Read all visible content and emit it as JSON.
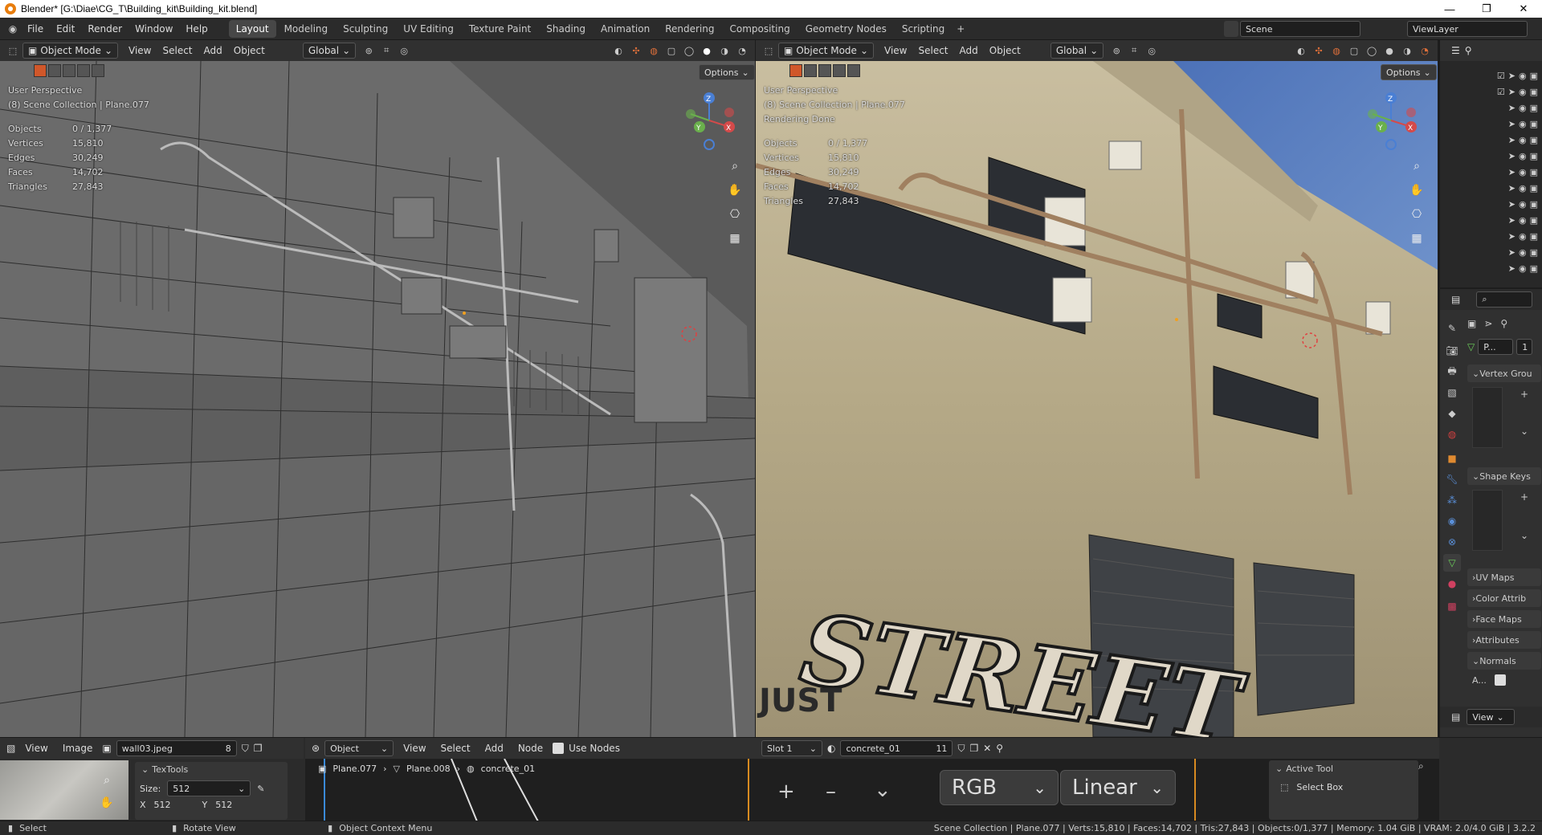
{
  "window": {
    "title": "Blender* [G:\\Diae\\CG_T\\Building_kit\\Building_kit.blend]"
  },
  "menu": [
    "File",
    "Edit",
    "Render",
    "Window",
    "Help"
  ],
  "workspaces": [
    "Layout",
    "Modeling",
    "Sculpting",
    "UV Editing",
    "Texture Paint",
    "Shading",
    "Animation",
    "Rendering",
    "Compositing",
    "Geometry Nodes",
    "Scripting"
  ],
  "scene": {
    "name": "Scene",
    "view_layer": "ViewLayer"
  },
  "viewport_header": {
    "mode": "Object Mode",
    "menus": [
      "View",
      "Select",
      "Add",
      "Object"
    ],
    "orientation": "Global"
  },
  "viewport_left": {
    "perspective": "User Perspective",
    "collection": "(8) Scene Collection | Plane.077",
    "options": "Options",
    "stats": [
      {
        "k": "Objects",
        "v": "0 / 1,377"
      },
      {
        "k": "Vertices",
        "v": "15,810"
      },
      {
        "k": "Edges",
        "v": "30,249"
      },
      {
        "k": "Faces",
        "v": "14,702"
      },
      {
        "k": "Triangles",
        "v": "27,843"
      }
    ]
  },
  "viewport_right": {
    "perspective": "User Perspective",
    "collection": "(8) Scene Collection | Plane.077",
    "rendering": "Rendering Done",
    "options": "Options",
    "stats": [
      {
        "k": "Objects",
        "v": "0 / 1,377"
      },
      {
        "k": "Vertices",
        "v": "15,810"
      },
      {
        "k": "Edges",
        "v": "30,249"
      },
      {
        "k": "Faces",
        "v": "14,702"
      },
      {
        "k": "Triangles",
        "v": "27,843"
      }
    ],
    "graffiti": "STREET",
    "graffiti2": "JUST"
  },
  "gizmo": {
    "x": "X",
    "y": "Y",
    "z": "Z"
  },
  "properties": {
    "object_short": "P...",
    "sections": [
      "Vertex Grou",
      "Shape Keys",
      "UV Maps",
      "Color Attrib",
      "Face Maps",
      "Attributes",
      "Normals"
    ],
    "auto_label": "A...",
    "view": "View"
  },
  "image_editor": {
    "menus": [
      "View",
      "Image"
    ],
    "image": "wall03.jpeg",
    "users": "8",
    "panel_title": "TexTools",
    "size_label": "Size:",
    "size_value": "512",
    "x_label": "X",
    "x_value": "512",
    "y_label": "Y",
    "y_value": "512"
  },
  "node_editor": {
    "type": "Object",
    "menus": [
      "View",
      "Select",
      "Add",
      "Node"
    ],
    "use_nodes": "Use Nodes",
    "slot": "Slot 1",
    "material": "concrete_01",
    "material_users": "11",
    "breadcrumbs": [
      "Plane.077",
      "Plane.008",
      "concrete_01"
    ],
    "color_mode": "RGB",
    "interpolation": "Linear",
    "active_tool_title": "Active Tool",
    "active_tool": "Select Box"
  },
  "status": {
    "select": "Select",
    "rotate": "Rotate View",
    "context": "Object Context Menu",
    "info": "Scene Collection | Plane.077 | Verts:15,810 | Faces:14,702 | Tris:27,843 | Objects:0/1,377 | Memory: 1.04 GiB | VRAM: 2.0/4.0 GiB | 3.2.2"
  }
}
